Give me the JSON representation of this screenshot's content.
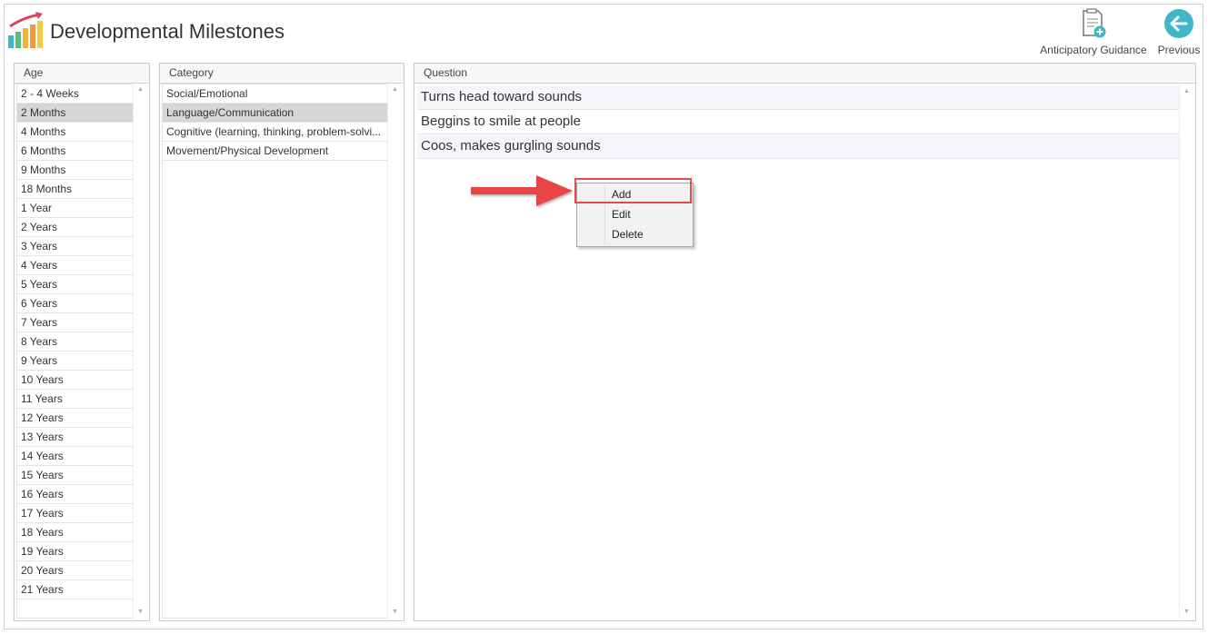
{
  "app": {
    "title": "Developmental Milestones"
  },
  "toolbar": {
    "guidance_label": "Anticipatory Guidance",
    "previous_label": "Previous"
  },
  "age_panel": {
    "header": "Age",
    "selected_index": 1,
    "items": [
      "2 - 4 Weeks",
      "2 Months",
      "4 Months",
      "6 Months",
      "9 Months",
      "18 Months",
      "1 Year",
      "2 Years",
      "3 Years",
      "4 Years",
      "5 Years",
      "6 Years",
      "7 Years",
      "8 Years",
      "9 Years",
      "10 Years",
      "11 Years",
      "12 Years",
      "13 Years",
      "14 Years",
      "15 Years",
      "16 Years",
      "17 Years",
      "18 Years",
      "19 Years",
      "20 Years",
      "21 Years"
    ]
  },
  "category_panel": {
    "header": "Category",
    "selected_index": 1,
    "items": [
      "Social/Emotional",
      "Language/Communication",
      "Cognitive (learning, thinking, problem-solvi...",
      "Movement/Physical Development"
    ]
  },
  "question_panel": {
    "header": "Question",
    "items": [
      "Turns head toward sounds",
      "Beggins to smile at people",
      "Coos, makes gurgling sounds"
    ]
  },
  "context_menu": {
    "add": "Add",
    "edit": "Edit",
    "delete": "Delete"
  },
  "icons": {
    "logo": "bar-chart-trend-icon",
    "guidance": "document-add-icon",
    "previous": "arrow-left-circle-icon"
  },
  "colors": {
    "accent": "#3fb7c8",
    "highlight": "#e34b4b",
    "selected": "#d6d6d6"
  }
}
